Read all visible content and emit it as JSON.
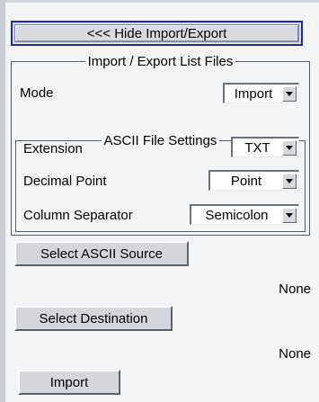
{
  "header": {
    "hide_button_label": "<<< Hide Import/Export"
  },
  "import_export_group": {
    "legend": "Import / Export List Files",
    "mode": {
      "label": "Mode",
      "value": "Import"
    },
    "ascii_settings": {
      "legend": "ASCII File Settings",
      "extension": {
        "label": "Extension",
        "value": "TXT"
      },
      "decimal_point": {
        "label": "Decimal Point",
        "value": "Point"
      },
      "column_separator": {
        "label": "Column Separator",
        "value": "Semicolon"
      }
    }
  },
  "source": {
    "button_label": "Select ASCII Source",
    "value": "None"
  },
  "destination": {
    "button_label": "Select Destination",
    "value": "None"
  },
  "actions": {
    "import_label": "Import"
  },
  "icons": {
    "dropdown": "chevron-down-icon"
  },
  "colors": {
    "focus_border": "#1d2f92",
    "panel_background": "#f3f4f6",
    "button_face": "#d4d6dc"
  }
}
